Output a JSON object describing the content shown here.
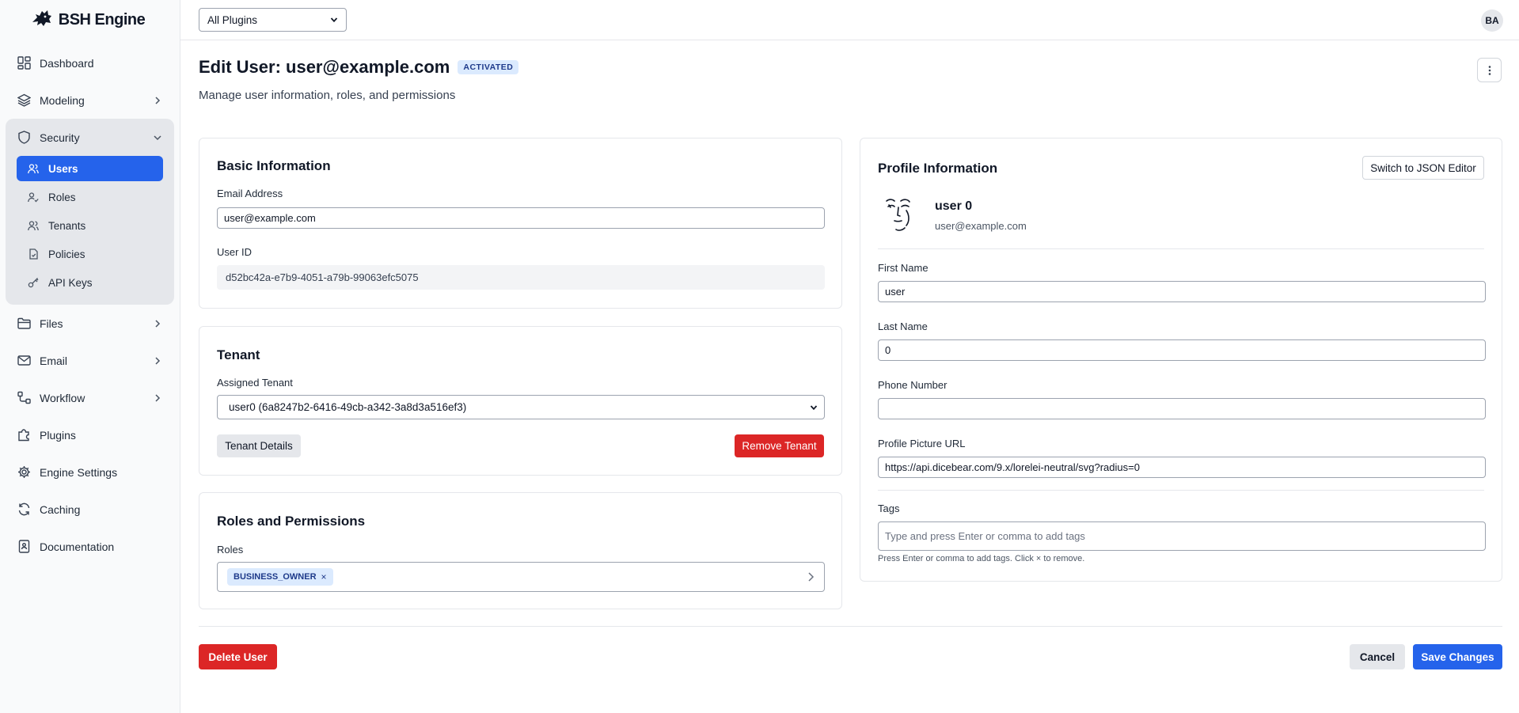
{
  "brand": {
    "name": "BSH Engine"
  },
  "sidebar": {
    "items": [
      {
        "label": "Dashboard",
        "icon": "dashboard-icon"
      },
      {
        "label": "Modeling",
        "icon": "layers-icon"
      },
      {
        "label": "Security",
        "icon": "shield-icon"
      },
      {
        "label": "Files",
        "icon": "folder-icon"
      },
      {
        "label": "Email",
        "icon": "mail-icon"
      },
      {
        "label": "Workflow",
        "icon": "workflow-icon"
      },
      {
        "label": "Plugins",
        "icon": "puzzle-icon"
      },
      {
        "label": "Engine Settings",
        "icon": "gear-icon"
      },
      {
        "label": "Caching",
        "icon": "refresh-icon"
      },
      {
        "label": "Documentation",
        "icon": "book-icon"
      }
    ],
    "security_sub": [
      {
        "label": "Users",
        "icon": "users-icon"
      },
      {
        "label": "Roles",
        "icon": "user-check-icon"
      },
      {
        "label": "Tenants",
        "icon": "tenants-icon"
      },
      {
        "label": "Policies",
        "icon": "policy-icon"
      },
      {
        "label": "API Keys",
        "icon": "key-icon"
      }
    ]
  },
  "topbar": {
    "plugin_filter": "All Plugins",
    "avatar_initials": "BA"
  },
  "header": {
    "title": "Edit User: user@example.com",
    "status_badge": "ACTIVATED",
    "subtitle": "Manage user information, roles, and permissions"
  },
  "basic": {
    "title": "Basic Information",
    "email_label": "Email Address",
    "email_value": "user@example.com",
    "id_label": "User ID",
    "id_value": "d52bc42a-e7b9-4051-a79b-99063efc5075"
  },
  "tenant": {
    "title": "Tenant",
    "assigned_label": "Assigned Tenant",
    "assigned_value": "user0 (6a8247b2-6416-49cb-a342-3a8d3a516ef3)",
    "details_button": "Tenant Details",
    "remove_button": "Remove Tenant"
  },
  "roles": {
    "title": "Roles and Permissions",
    "label": "Roles",
    "chips": [
      "BUSINESS_OWNER"
    ]
  },
  "profile": {
    "title": "Profile Information",
    "json_button": "Switch to JSON Editor",
    "display_name": "user 0",
    "display_email": "user@example.com",
    "first_name_label": "First Name",
    "first_name_value": "user",
    "last_name_label": "Last Name",
    "last_name_value": "0",
    "phone_label": "Phone Number",
    "phone_value": "",
    "picture_label": "Profile Picture URL",
    "picture_value": "https://api.dicebear.com/9.x/lorelei-neutral/svg?radius=0",
    "tags_label": "Tags",
    "tags_placeholder": "Type and press Enter or comma to add tags",
    "tags_help": "Press Enter or comma to add tags. Click × to remove."
  },
  "footer": {
    "delete_button": "Delete User",
    "cancel_button": "Cancel",
    "save_button": "Save Changes"
  }
}
